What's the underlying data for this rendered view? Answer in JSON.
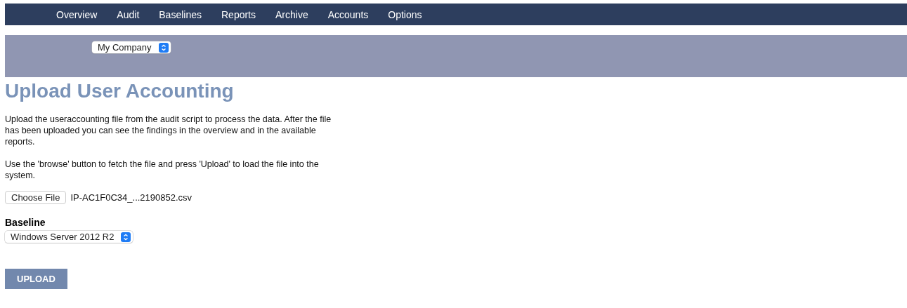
{
  "nav": {
    "items": [
      {
        "label": "Overview"
      },
      {
        "label": "Audit"
      },
      {
        "label": "Baselines"
      },
      {
        "label": "Reports"
      },
      {
        "label": "Archive"
      },
      {
        "label": "Accounts"
      },
      {
        "label": "Options"
      }
    ]
  },
  "company_select": {
    "value": "My Company"
  },
  "title": "Upload User Accounting",
  "paragraphs": [
    "Upload the useraccounting file from the audit script to process the data. After the file has been uploaded you can see the findings in the overview and in the available reports.",
    "Use the 'browse' button to fetch the file and press 'Upload' to load the file into the system."
  ],
  "file_picker": {
    "button": "Choose File",
    "file_name": "IP-AC1F0C34_...2190852.csv"
  },
  "baseline": {
    "label": "Baseline",
    "value": "Windows Server 2012 R2"
  },
  "upload_button": "UPLOAD"
}
